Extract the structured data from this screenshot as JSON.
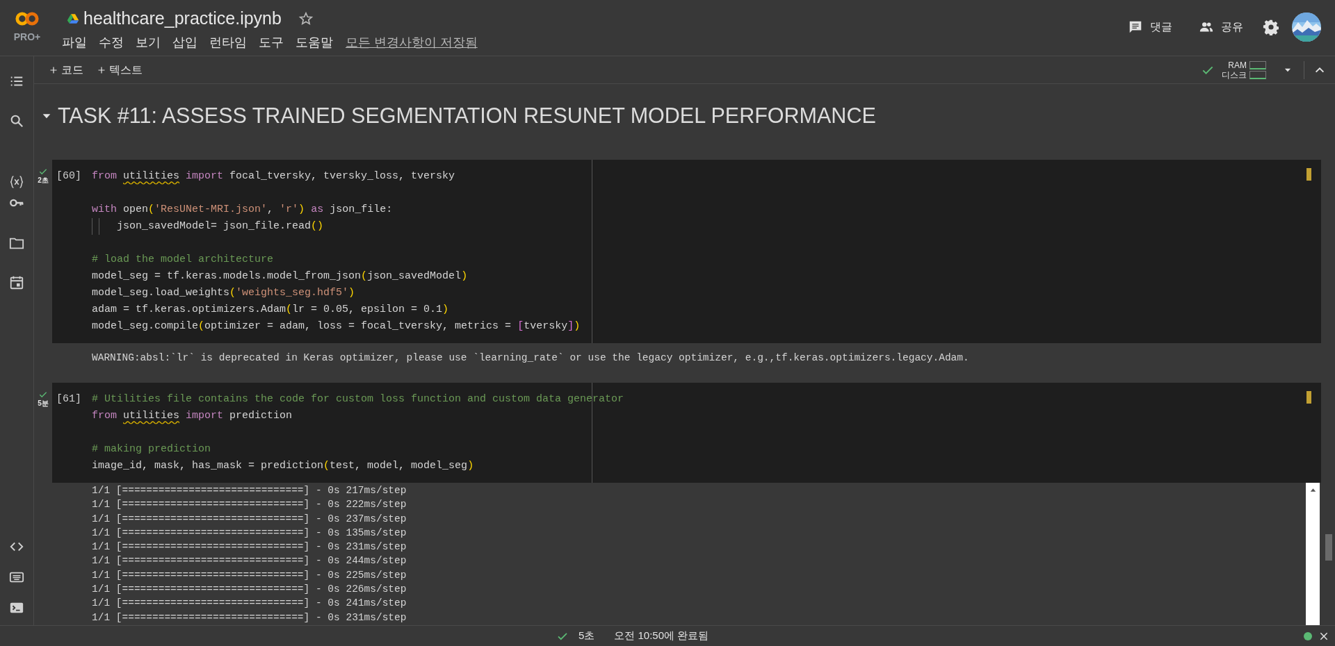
{
  "header": {
    "logo_badge": "PRO+",
    "title": "healthcare_practice.ipynb",
    "starred": false,
    "menu": [
      "파일",
      "수정",
      "보기",
      "삽입",
      "런타임",
      "도구",
      "도움말"
    ],
    "save_status": "모든 변경사항이 저장됨",
    "actions": [
      {
        "kind": "comment",
        "label": "댓글"
      },
      {
        "kind": "share",
        "label": "공유"
      }
    ]
  },
  "toolbar": {
    "add_buttons": [
      "코드",
      "텍스트"
    ],
    "runtime": {
      "connected": true,
      "ram_label": "RAM",
      "disk_label": "디스크"
    }
  },
  "section": {
    "title": "TASK #11: ASSESS TRAINED SEGMENTATION RESUNET MODEL PERFORMANCE",
    "expanded": true
  },
  "cells": [
    {
      "count": "[60]",
      "succeeded": true,
      "duration": "2초",
      "lines": [
        {
          "kind": "code",
          "tokens": [
            {
              "kind": "keyword",
              "text": "from "
            },
            {
              "kind": "warn",
              "text": "utilities"
            },
            {
              "kind": "keyword",
              "text": " import"
            },
            {
              "kind": "plain",
              "text": " focal_tversky, tversky_loss, tversky"
            }
          ]
        },
        {
          "kind": "blank"
        },
        {
          "kind": "code",
          "tokens": [
            {
              "kind": "keyword",
              "text": "with"
            },
            {
              "kind": "plain",
              "text": " open"
            },
            {
              "kind": "bracket",
              "text": "("
            },
            {
              "kind": "string",
              "text": "'ResUNet-MRI.json'"
            },
            {
              "kind": "plain",
              "text": ", "
            },
            {
              "kind": "string",
              "text": "'r'"
            },
            {
              "kind": "bracket",
              "text": ")"
            },
            {
              "kind": "keyword",
              "text": " as"
            },
            {
              "kind": "plain",
              "text": " json_file:"
            }
          ]
        },
        {
          "kind": "code",
          "guides": true,
          "tokens": [
            {
              "kind": "plain",
              "text": "json_savedModel= json_file.read"
            },
            {
              "kind": "bracket",
              "text": "()"
            }
          ]
        },
        {
          "kind": "blank"
        },
        {
          "kind": "code",
          "tokens": [
            {
              "kind": "comment",
              "text": "# load the model architecture"
            }
          ]
        },
        {
          "kind": "code",
          "tokens": [
            {
              "kind": "plain",
              "text": "model_seg = tf.keras.models.model_from_json"
            },
            {
              "kind": "bracket",
              "text": "("
            },
            {
              "kind": "plain",
              "text": "json_savedModel"
            },
            {
              "kind": "bracket",
              "text": ")"
            }
          ]
        },
        {
          "kind": "code",
          "tokens": [
            {
              "kind": "plain",
              "text": "model_seg.load_weights"
            },
            {
              "kind": "bracket",
              "text": "("
            },
            {
              "kind": "string",
              "text": "'weights_seg.hdf5'"
            },
            {
              "kind": "bracket",
              "text": ")"
            }
          ]
        },
        {
          "kind": "code",
          "tokens": [
            {
              "kind": "plain",
              "text": "adam = tf.keras.optimizers.Adam"
            },
            {
              "kind": "bracket",
              "text": "("
            },
            {
              "kind": "plain",
              "text": "lr = 0.05, epsilon = 0.1"
            },
            {
              "kind": "bracket",
              "text": ")"
            }
          ]
        },
        {
          "kind": "code",
          "tokens": [
            {
              "kind": "plain",
              "text": "model_seg.compile"
            },
            {
              "kind": "bracket",
              "text": "("
            },
            {
              "kind": "plain",
              "text": "optimizer = adam, loss = focal_tversky, metrics = "
            },
            {
              "kind": "bracket2",
              "text": "["
            },
            {
              "kind": "plain",
              "text": "tversky"
            },
            {
              "kind": "bracket2",
              "text": "]"
            },
            {
              "kind": "bracket",
              "text": ")"
            }
          ]
        }
      ],
      "output": {
        "kind": "text",
        "lines": [
          "WARNING:absl:`lr` is deprecated in Keras optimizer, please use `learning_rate` or use the legacy optimizer, e.g.,tf.keras.optimizers.legacy.Adam."
        ]
      }
    },
    {
      "count": "[61]",
      "succeeded": true,
      "duration": "5분",
      "lines": [
        {
          "kind": "code",
          "tokens": [
            {
              "kind": "comment",
              "text": "# Utilities file contains the code for custom loss function and custom data generator"
            }
          ]
        },
        {
          "kind": "code",
          "tokens": [
            {
              "kind": "keyword",
              "text": "from "
            },
            {
              "kind": "warn",
              "text": "utilities"
            },
            {
              "kind": "keyword",
              "text": " import"
            },
            {
              "kind": "plain",
              "text": " prediction"
            }
          ]
        },
        {
          "kind": "blank"
        },
        {
          "kind": "code",
          "tokens": [
            {
              "kind": "comment",
              "text": "# making prediction"
            }
          ]
        },
        {
          "kind": "code",
          "tokens": [
            {
              "kind": "plain",
              "text": "image_id, mask, has_mask = prediction"
            },
            {
              "kind": "bracket",
              "text": "("
            },
            {
              "kind": "plain",
              "text": "test, model, model_seg"
            },
            {
              "kind": "bracket",
              "text": ")"
            }
          ]
        }
      ],
      "output": {
        "kind": "scroll",
        "lines": [
          "1/1 [==============================] - 0s 217ms/step",
          "1/1 [==============================] - 0s 222ms/step",
          "1/1 [==============================] - 0s 237ms/step",
          "1/1 [==============================] - 0s 135ms/step",
          "1/1 [==============================] - 0s 231ms/step",
          "1/1 [==============================] - 0s 244ms/step",
          "1/1 [==============================] - 0s 225ms/step",
          "1/1 [==============================] - 0s 226ms/step",
          "1/1 [==============================] - 0s 241ms/step",
          "1/1 [==============================] - 0s 231ms/step"
        ]
      }
    }
  ],
  "status_bar": {
    "succeeded": true,
    "duration": "5초",
    "message": "오전 10:50에 완료됨",
    "connected": true
  }
}
